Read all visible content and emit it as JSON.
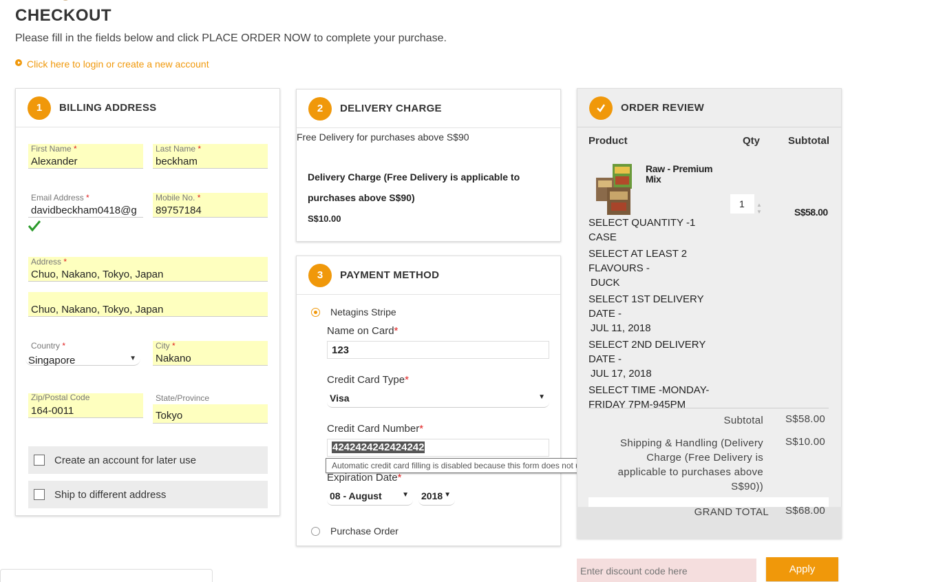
{
  "page": {
    "title": "CHECKOUT",
    "intro": "Please fill in the fields below and click PLACE ORDER NOW to complete your purchase.",
    "login_link": "Click here to login or create a new account",
    "accent_color": "#f0980a"
  },
  "billing": {
    "step": "1",
    "title": "BILLING ADDRESS",
    "first_name": {
      "label": "First Name",
      "value": "Alexander"
    },
    "last_name": {
      "label": "Last Name",
      "value": "beckham"
    },
    "email": {
      "label": "Email Address",
      "value": "davidbeckham0418@g"
    },
    "mobile": {
      "label": "Mobile No.",
      "value": "89757184"
    },
    "address": {
      "label": "Address",
      "line1": "Chuo, Nakano, Tokyo, Japan",
      "line2": "Chuo, Nakano, Tokyo, Japan"
    },
    "country": {
      "label": "Country",
      "value": "Singapore"
    },
    "city": {
      "label": "City",
      "value": "Nakano"
    },
    "zip": {
      "label": "Zip/Postal Code",
      "value": "164-0011"
    },
    "state": {
      "label": "State/Province",
      "value": "Tokyo"
    },
    "create_account": "Create an account for later use",
    "ship_different": "Ship to different address",
    "required_mark": "*"
  },
  "delivery": {
    "step": "2",
    "title": "DELIVERY CHARGE",
    "free_note": "Free Delivery for purchases above S$90",
    "description": "Delivery Charge (Free Delivery is applicable to purchases above S$90)",
    "price": "S$10.00"
  },
  "payment": {
    "step": "3",
    "title": "PAYMENT METHOD",
    "method_stripe": "Netagins Stripe",
    "name_label": "Name on Card",
    "name_value": "123",
    "type_label": "Credit Card Type",
    "type_value": "Visa",
    "number_label": "Credit Card Number",
    "number_value": "4242424242424242",
    "expiry_label": "Expiration Date",
    "expiry_month": "08 - August",
    "expiry_year": "2018",
    "method_po": "Purchase Order",
    "tooltip": "Automatic credit card filling is disabled because this form does not use a secure connection."
  },
  "review": {
    "title": "ORDER REVIEW",
    "step_icon": "check-icon",
    "col_product": "Product",
    "col_qty": "Qty",
    "col_subtotal": "Subtotal",
    "product_name": "Raw - Premium Mix",
    "qty": "1",
    "item_subtotal": "S$58.00",
    "options": [
      {
        "label": "SELECT QUANTITY -1 CASE",
        "value": ""
      },
      {
        "label": "SELECT AT LEAST 2 FLAVOURS -",
        "value": "DUCK"
      },
      {
        "label": "SELECT 1ST DELIVERY DATE -",
        "value": "JUL 11, 2018"
      },
      {
        "label": "SELECT 2ND DELIVERY DATE -",
        "value": "JUL 17, 2018"
      },
      {
        "label": "SELECT TIME -MONDAY-FRIDAY 7PM-945PM",
        "value": ""
      }
    ],
    "subtotal_label": "Subtotal",
    "subtotal_value": "S$58.00",
    "shipping_label": "Shipping & Handling (Delivery Charge (Free Delivery is applicable to purchases above S$90))",
    "shipping_value": "S$10.00",
    "grand_label": "GRAND TOTAL",
    "grand_value": "S$68.00"
  },
  "discount": {
    "placeholder": "Enter discount code here",
    "apply_label": "Apply"
  }
}
